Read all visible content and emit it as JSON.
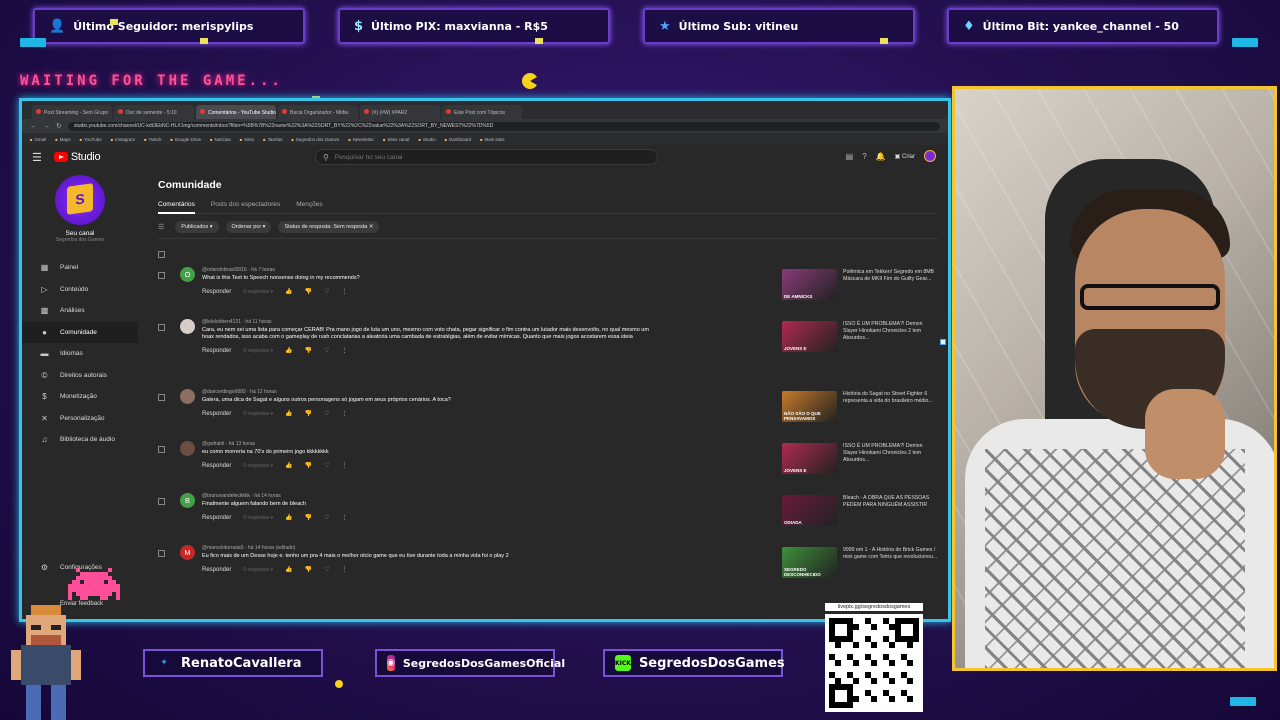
{
  "banners": [
    {
      "icon": "user-icon",
      "label": "Último Seguidor: merispylips"
    },
    {
      "icon": "money-icon",
      "label": "Último PIX: maxvianna - R$5"
    },
    {
      "icon": "star-icon",
      "label": "Último Sub: vitineu"
    },
    {
      "icon": "diamond-icon",
      "label": "Último Bit: yankee_channel - 50"
    }
  ],
  "waiting_text": "WAITING FOR THE GAME...",
  "browser": {
    "tabs": [
      "Post Streaming - Sem Grupo",
      "Doc de semente - 5:10",
      "Comentários - YouTube Studio",
      "Bacia Organizador - Mídia",
      "(#) (#W) #PAR2",
      "Este Post com Tópicos"
    ],
    "url": "studio.youtube.com/channel/UC-kdt3EbNC-HLX1mg/comments/inbox?filter=%5B%7B%22name%22%3A%22SORT_BY%22%2C%22value%22%3A%22SORT_BY_NEWEST%22%7D%5D",
    "bookmarks": [
      "Gmail",
      "Maps",
      "YouTube",
      "Instagram",
      "Twitch",
      "Google Drive",
      "Notícias",
      "Sites",
      "Tarefas",
      "Segredos dos Games",
      "Newsletter",
      "Sites canal",
      "Studio",
      "Dashboard",
      "Mais sites"
    ]
  },
  "studio": {
    "logo_text": "Studio",
    "search_placeholder": "Pesquisar no seu canal",
    "create_label": "Criar",
    "channel_label": "Seu canal",
    "channel_name": "Segredos dos Games",
    "nav": [
      {
        "icon": "dashboard-icon",
        "label": "Painel"
      },
      {
        "icon": "content-icon",
        "label": "Conteúdo"
      },
      {
        "icon": "analytics-icon",
        "label": "Análises"
      },
      {
        "icon": "community-icon",
        "label": "Comunidade"
      },
      {
        "icon": "subtitles-icon",
        "label": "Idiomas"
      },
      {
        "icon": "copyright-icon",
        "label": "Direitos autorais"
      },
      {
        "icon": "money-icon",
        "label": "Monetização"
      },
      {
        "icon": "customize-icon",
        "label": "Personalização"
      },
      {
        "icon": "audio-library-icon",
        "label": "Biblioteca de áudio"
      }
    ],
    "settings_label": "Configurações",
    "feedback_label": "Enviar feedback",
    "page_title": "Comunidade",
    "subtabs": [
      "Comentários",
      "Posts dos espectadores",
      "Menções"
    ],
    "filters": [
      "Publicados",
      "Ordenar por",
      "Status de resposta: Sem resposta"
    ],
    "reply_label": "Responder",
    "replies_label": "0 respostas",
    "comments": [
      {
        "initial": "O",
        "color": "#43a047",
        "author": "@orlandobrasil3016 · há 7 horas",
        "text": "What is this Text to Speech nonsense doing in my recommends?",
        "video_title": "Polêmica em Tekken! Segredo em 8MB Máscara de MKII Fim do Guilty Gear...",
        "thumb_label": "DE AMNICKS",
        "thumb_color": "#8a3b7a"
      },
      {
        "initial": "",
        "color": "#d7ccc8",
        "author": "@leleleldren4131 · há 11 horas",
        "text": "Cara, eu nem sei uma lista para começar CERAB! Pra mano jogo de luta um uno, mesmo com voto chata, pegar significar o fim contra um lutador mais desenvolto, no qual mesmo um hoax rendados, isso acaba com o gameplay de rush conclatarias a aleatoria uma cambada de estratégias, além de evitar mímicas. Quanto que mais jogos acostarem essa ideia",
        "video_title": "ISSO É UM PROBLEMA?! Demon Slayer Hinokami Chronicles 2 tem Absurdos...",
        "thumb_label": "JOVENS E",
        "thumb_color": "#b02a52"
      },
      {
        "initial": "",
        "color": "#8d6e63",
        "author": "@daricerdingo6880 · há 12 horas",
        "text": "Galera, uma dica de Sagat e alguns outros personagens só jogam em seus próprios cenários. A toca?",
        "video_title": "História do Sagat no Street Fighter 6 representa a vida do brasileiro médio...",
        "thumb_label": "NÃO SÃO O QUE PENSAVAMOS",
        "thumb_color": "#c77a2a"
      },
      {
        "initial": "",
        "color": "#6d4c41",
        "author": "@gwfraldi · há 13 horas",
        "text": "eu como morreria na 70's do primeiro jogo kkkkkkkk",
        "video_title": "ISSO É UM PROBLEMA?! Demon Slayer Hinokami Chronicles 2 tem Absurdos...",
        "thumb_label": "JOVENS E",
        "thumb_color": "#b02a52"
      },
      {
        "initial": "B",
        "color": "#43a047",
        "author": "@brunovandeleckkkk · há 14 horas",
        "text": "Finalmente alguem falando bem de bleach",
        "video_title": "Bleach - A OBRA QUE AS PESSOAS PEDEM PARA NINGUÉM ASSISTIR",
        "thumb_label": "ODIADA",
        "thumb_color": "#6a1b3a"
      },
      {
        "initial": "M",
        "color": "#c62828",
        "author": "@marcelotorrada5 · há 14 horas (editado)",
        "text": "Eu fico mais de um Desse hoje e. tenho um pra 4 mais o melhor otcio game que eu tive durante toda a minha vida foi o play 2",
        "video_title": "9999 em 1 - A História do Brick Games / mini game com Tetris que revolucionou...",
        "thumb_label": "SEGREDO DESCONHECIDO",
        "thumb_color": "#3f8f3a"
      }
    ]
  },
  "social": [
    {
      "icon": "twitter-icon",
      "label": "RenatoCavallera"
    },
    {
      "icon": "instagram-icon",
      "label": "SegredosDosGamesOficial"
    },
    {
      "icon": "kick-icon",
      "badge": "KICK",
      "label": "SegredosDosGames"
    }
  ],
  "qr_label": "livepix.gg/segredosdosgames",
  "colors": {
    "accent_cyan": "#38c3ea",
    "accent_purple": "#6b3cc9",
    "cam_border": "#f5c530",
    "waiting_pink": "#ff4f9b",
    "yt_red": "#ff0000"
  }
}
